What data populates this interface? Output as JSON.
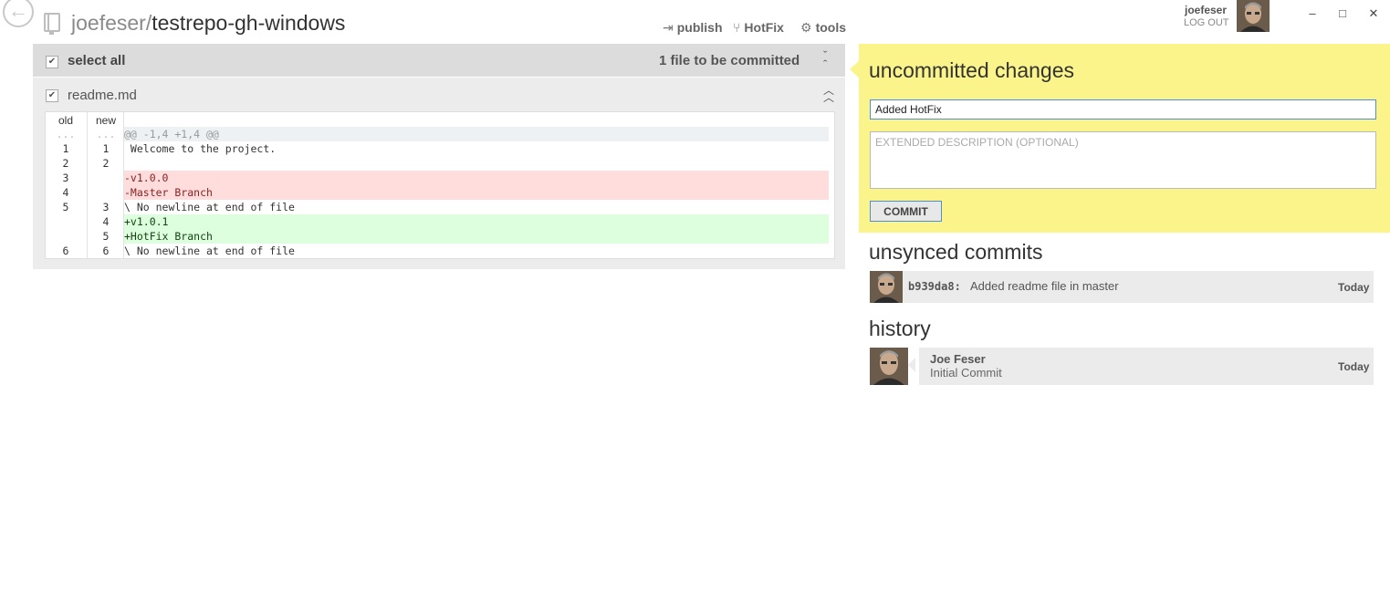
{
  "header": {
    "repo_owner": "joefeser",
    "repo_separator": "/",
    "repo_name": "testrepo-gh-windows",
    "actions": [
      {
        "glyph": "⇥",
        "label": "publish"
      },
      {
        "glyph": "⑂",
        "label": "HotFix"
      },
      {
        "glyph": "⚙",
        "label": "tools"
      }
    ]
  },
  "account": {
    "username": "joefeser",
    "logout": "LOG OUT"
  },
  "window": {
    "minimize": "–",
    "maximize": "□",
    "close": "✕"
  },
  "changes": {
    "select_all": "select all",
    "files_count": "1 file to be committed",
    "files": [
      {
        "name": "readme.md",
        "diff": {
          "col_old": "old",
          "col_new": "new",
          "rows": [
            {
              "type": "hunk",
              "old": "...",
              "new": "...",
              "code": "@@ -1,4 +1,4 @@"
            },
            {
              "type": "ctx",
              "old": "1",
              "new": "1",
              "code": " Welcome to the project."
            },
            {
              "type": "ctx",
              "old": "2",
              "new": "2",
              "code": ""
            },
            {
              "type": "del",
              "old": "3",
              "new": "",
              "code": "-v1.0.0"
            },
            {
              "type": "del",
              "old": "4",
              "new": "",
              "code": "-Master Branch"
            },
            {
              "type": "ctx",
              "old": "5",
              "new": "3",
              "code": "\\ No newline at end of file"
            },
            {
              "type": "add",
              "old": "",
              "new": "4",
              "code": "+v1.0.1"
            },
            {
              "type": "add",
              "old": "",
              "new": "5",
              "code": "+HotFix Branch"
            },
            {
              "type": "ctx",
              "old": "6",
              "new": "6",
              "code": "\\ No newline at end of file"
            }
          ]
        }
      }
    ]
  },
  "uncommitted": {
    "title": "uncommitted changes",
    "summary_value": "Added HotFix",
    "description_placeholder": "EXTENDED DESCRIPTION (OPTIONAL)",
    "commit_label": "COMMIT"
  },
  "unsynced": {
    "title": "unsynced commits",
    "commits": [
      {
        "sha": "b939da8:",
        "message": "Added readme file in master",
        "date": "Today"
      }
    ]
  },
  "history": {
    "title": "history",
    "commits": [
      {
        "author": "Joe Feser",
        "message": "Initial Commit",
        "date": "Today"
      }
    ]
  },
  "colors": {
    "panel_yellow": "#fbf48a",
    "focus_blue": "#4f8fd6",
    "diff_add": "#ddffdd",
    "diff_del": "#ffdddd"
  }
}
